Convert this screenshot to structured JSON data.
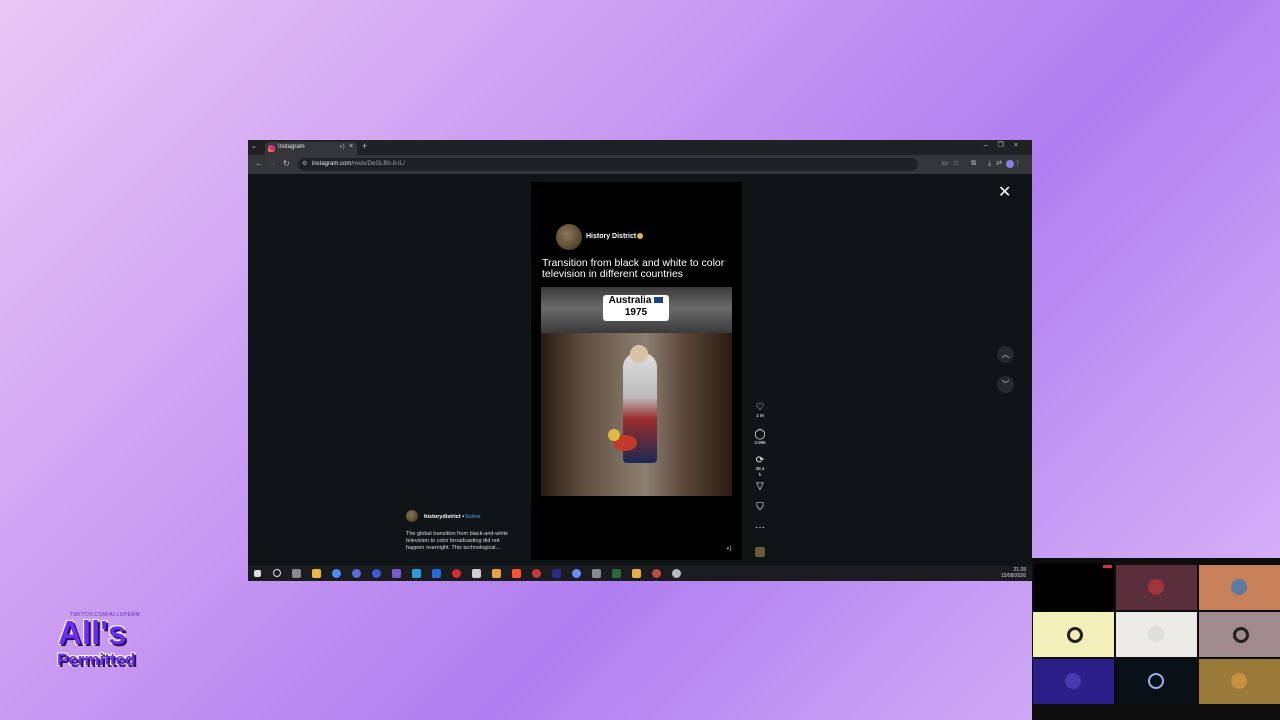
{
  "browser": {
    "tab_title": "Instagram",
    "url_host": "instagram.com",
    "url_path": "/reels/DeGLBh-8-tL/"
  },
  "post": {
    "account_name": "History District",
    "headline": "Transition from black and white to color television in different countries",
    "video_label_country": "Australia",
    "video_label_year": "1975",
    "likes": "2 M",
    "comments": "3.996",
    "reposts": "38,4 k",
    "caption_user": "historydistrict",
    "caption_sep": "•",
    "caption_follow": "Suivre",
    "caption_text": "The global transition from black-and-white television to color broadcasting did not happen overnight. This technological..."
  },
  "taskbar": {
    "time": "21:28",
    "date": "15/08/2026"
  },
  "logo": {
    "small_text": "TWITCH.COM/ALLSPERM",
    "line1": "All's",
    "line2": "Permitted"
  },
  "colors": {
    "background_start": "#e9c7f5",
    "background_mid": "#b07ef0",
    "logo_purple": "#6c2ef5",
    "instagram_follow": "#4fa8ff",
    "verified": "#e0b33c"
  },
  "icons": [
    "chevron-down-icon",
    "close-icon",
    "heart-icon",
    "comment-icon",
    "repost-icon",
    "share-icon",
    "bookmark-icon",
    "more-icon",
    "arrow-up-icon",
    "arrow-down-icon",
    "speaker-icon"
  ]
}
